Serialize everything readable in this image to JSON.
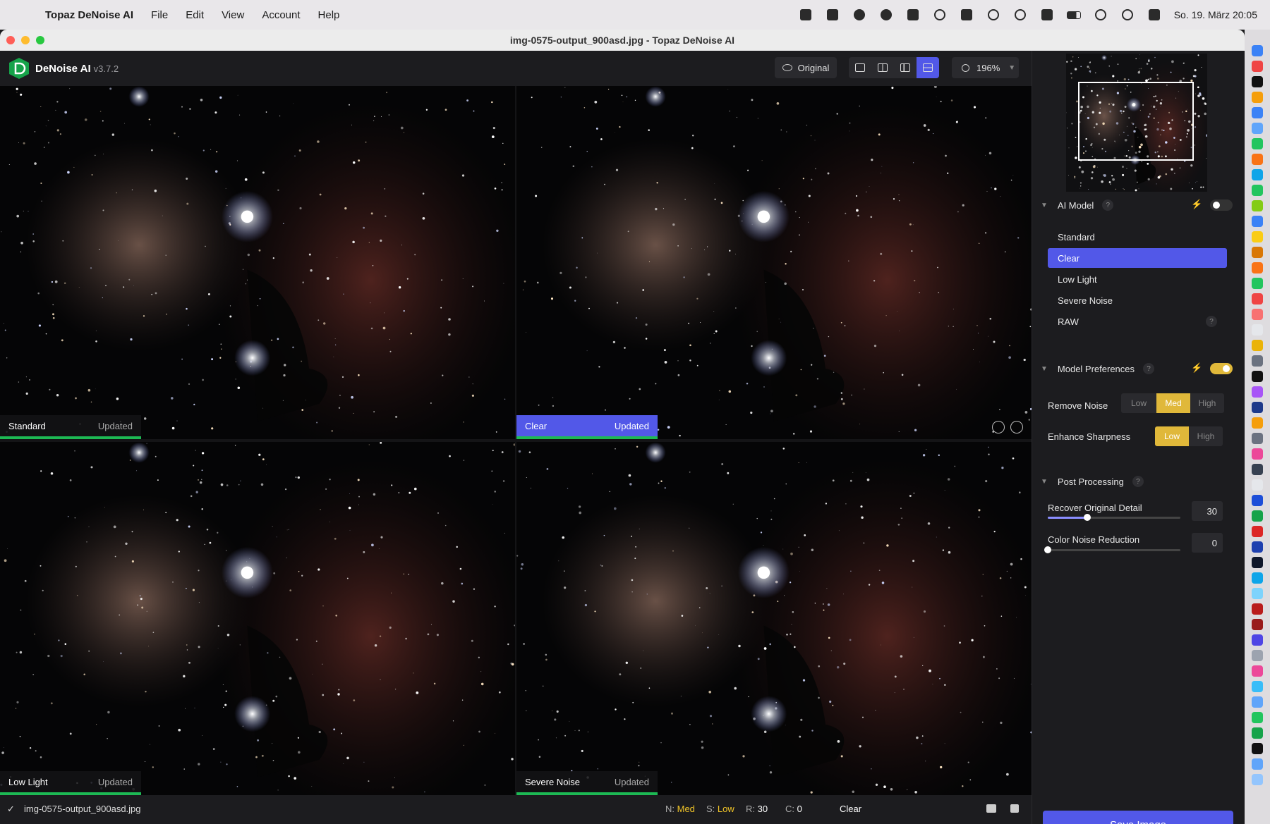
{
  "menubar": {
    "app_name": "Topaz DeNoise AI",
    "items": [
      "File",
      "Edit",
      "View",
      "Account",
      "Help"
    ],
    "clock": "So. 19. März  20:05"
  },
  "window": {
    "title": "img-0575-output_900asd.jpg - Topaz DeNoise AI"
  },
  "toolbar": {
    "app_title": "DeNoise AI",
    "version": "v3.7.2",
    "original_label": "Original",
    "zoom_level": "196%"
  },
  "panes": [
    {
      "label": "Standard",
      "status": "Updated",
      "selected": false
    },
    {
      "label": "Clear",
      "status": "Updated",
      "selected": true
    },
    {
      "label": "Low Light",
      "status": "Updated",
      "selected": false
    },
    {
      "label": "Severe Noise",
      "status": "Updated",
      "selected": false
    }
  ],
  "statusbar": {
    "filename": "img-0575-output_900asd.jpg",
    "noise_key": "N:",
    "noise_val": "Med",
    "sharp_key": "S:",
    "sharp_val": "Low",
    "recover_key": "R:",
    "recover_val": "30",
    "color_key": "C:",
    "color_val": "0",
    "model": "Clear"
  },
  "sidebar": {
    "ai_model": {
      "title": "AI Model",
      "help": "?",
      "models": [
        "Standard",
        "Clear",
        "Low Light",
        "Severe Noise",
        "RAW"
      ],
      "selected": "Clear",
      "raw_help": "?"
    },
    "model_prefs": {
      "title": "Model Preferences",
      "help": "?",
      "remove_noise": {
        "label": "Remove Noise",
        "options": [
          "Low",
          "Med",
          "High"
        ],
        "selected": "Med"
      },
      "enhance_sharpness": {
        "label": "Enhance Sharpness",
        "options": [
          "Low",
          "High"
        ],
        "selected": "Low"
      }
    },
    "post_processing": {
      "title": "Post Processing",
      "help": "?",
      "recover_detail": {
        "label": "Recover Original Detail",
        "value": "30",
        "fraction": 0.3
      },
      "color_noise": {
        "label": "Color Noise Reduction",
        "value": "0",
        "fraction": 0.0
      }
    },
    "save_label": "Save Image"
  },
  "colors": {
    "accent": "#5258e8",
    "active_gold": "#e0b83a",
    "updated_green": "#1db954"
  }
}
